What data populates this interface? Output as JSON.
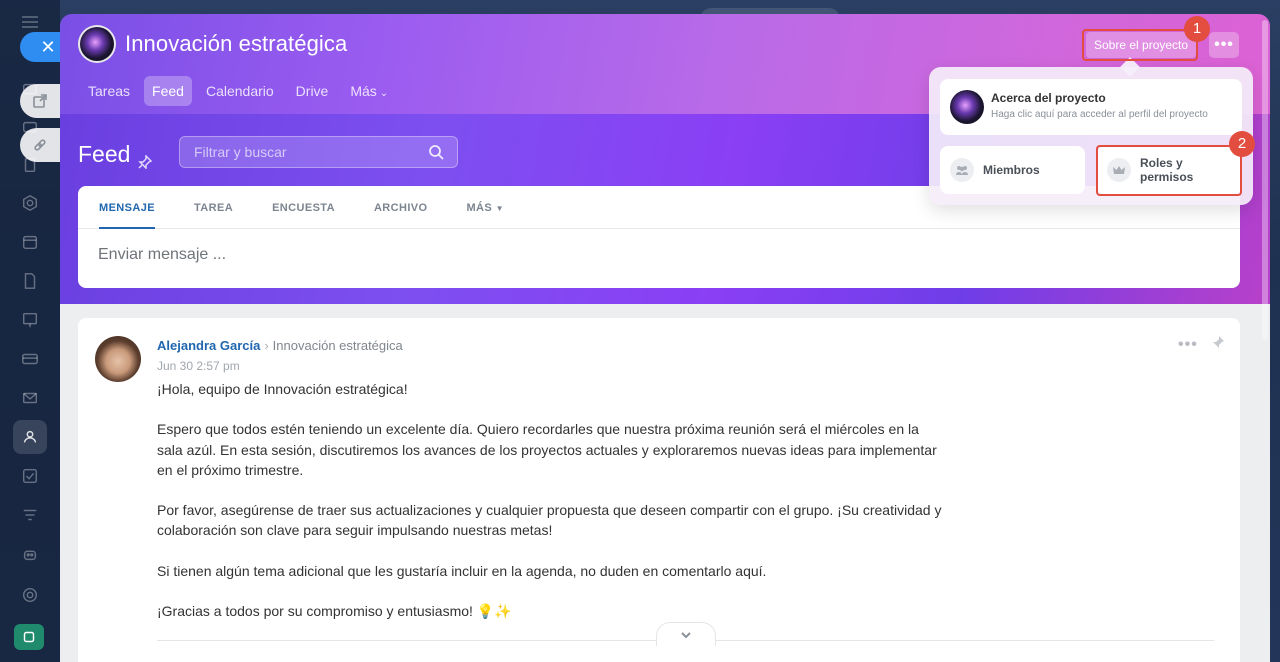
{
  "project": {
    "title": "Innovación estratégica",
    "about_button": "Sobre el proyecto",
    "more_button": "•••"
  },
  "tabs": [
    {
      "label": "Tareas"
    },
    {
      "label": "Feed"
    },
    {
      "label": "Calendario"
    },
    {
      "label": "Drive"
    },
    {
      "label": "Más"
    }
  ],
  "feed": {
    "title": "Feed",
    "search_placeholder": "Filtrar y buscar"
  },
  "composer": {
    "tabs": [
      "MENSAJE",
      "TAREA",
      "ENCUESTA",
      "ARCHIVO",
      "MÁS"
    ],
    "placeholder": "Enviar mensaje ..."
  },
  "post": {
    "author": "Alejandra García",
    "destination": "Innovación estratégica",
    "date": "Jun 30 2:57 pm",
    "paragraphs": [
      "¡Hola, equipo de Innovación estratégica!",
      "Espero que todos estén teniendo un excelente día. Quiero recordarles que nuestra próxima reunión será el miércoles en la sala azúl. En esta sesión, discutiremos los avances de los proyectos actuales y exploraremos nuevas ideas para implementar en el próximo trimestre.",
      "Por favor, asegúrense de traer sus actualizaciones y cualquier propuesta que deseen compartir con el grupo. ¡Su creatividad y colaboración son clave para seguir impulsando nuestras metas!",
      "Si tienen algún tema adicional que les gustaría incluir en la agenda, no duden en comentarlo aquí.",
      "¡Gracias a todos por su compromiso y entusiasmo! 💡✨"
    ]
  },
  "dropdown": {
    "about_title": "Acerca del proyecto",
    "about_subtitle": "Haga clic aquí para acceder al perfil del proyecto",
    "members": "Miembros",
    "roles": "Roles y permisos"
  },
  "annotations": {
    "step1": "1",
    "step2": "2"
  },
  "colors": {
    "accent_blue": "#2067b0",
    "highlight_red": "#e24d3f",
    "close_button": "#2f8cf0"
  }
}
